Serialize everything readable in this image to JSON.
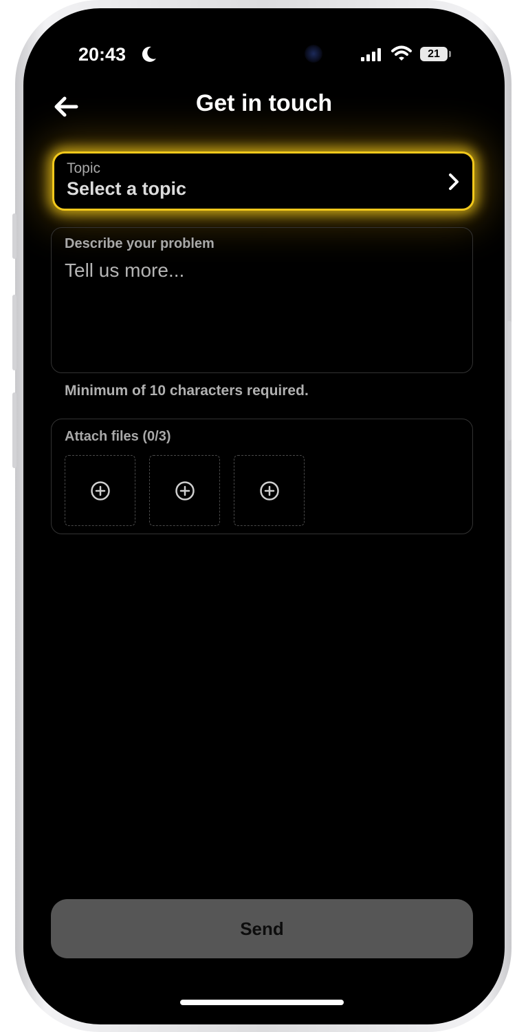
{
  "status_bar": {
    "time": "20:43",
    "battery": "21"
  },
  "header": {
    "title": "Get in touch"
  },
  "topic": {
    "label": "Topic",
    "value": "Select a topic"
  },
  "description": {
    "label": "Describe your problem",
    "placeholder": "Tell us more...",
    "hint": "Minimum of 10 characters required."
  },
  "attachments": {
    "label": "Attach files (0/3)",
    "slots": 3
  },
  "send": {
    "label": "Send"
  },
  "colors": {
    "accent_glow": "#f2c81b",
    "background": "#000000",
    "button_disabled": "#565656"
  }
}
